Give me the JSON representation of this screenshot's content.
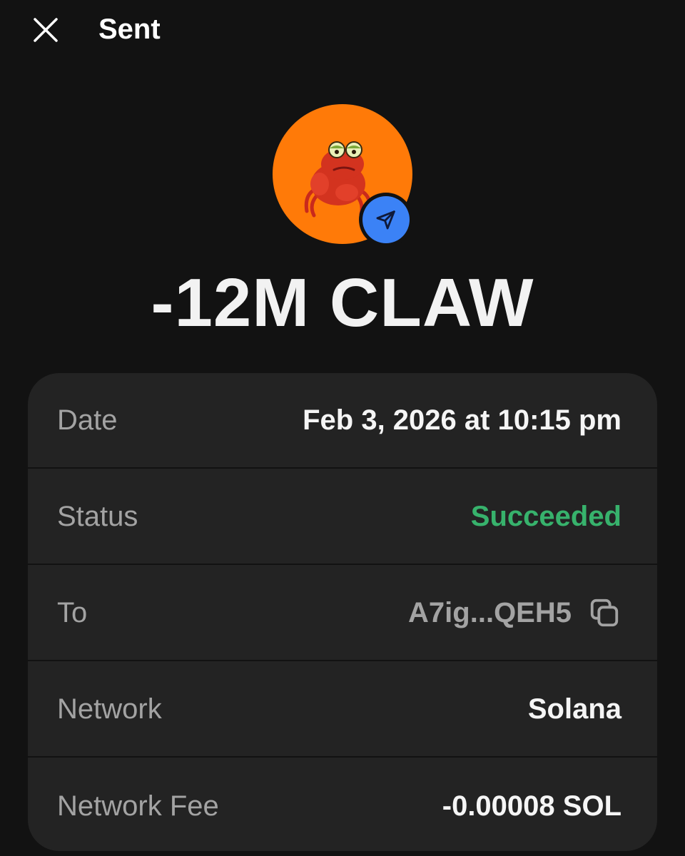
{
  "header": {
    "title": "Sent",
    "close_icon": "close-icon"
  },
  "token": {
    "avatar_icon": "claw-crab-token-avatar",
    "badge_icon": "send-arrow-icon",
    "avatar_color": "#ff7a08",
    "badge_color": "#3b82f6"
  },
  "amount": "-12M CLAW",
  "details": {
    "date": {
      "label": "Date",
      "value": "Feb 3, 2026 at 10:15 pm"
    },
    "status": {
      "label": "Status",
      "value": "Succeeded",
      "color": "#37b26c"
    },
    "to": {
      "label": "To",
      "value": "A7ig...QEH5",
      "copy_icon": "copy-icon"
    },
    "network": {
      "label": "Network",
      "value": "Solana"
    },
    "fee": {
      "label": "Network Fee",
      "value": "-0.00008 SOL"
    }
  }
}
